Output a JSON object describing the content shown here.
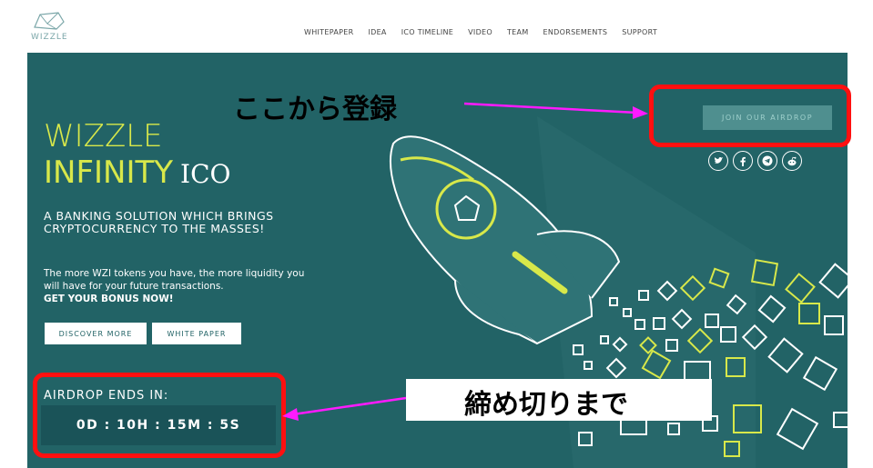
{
  "header": {
    "logo_text": "WIZZLE",
    "nav": [
      "WHITEPAPER",
      "IDEA",
      "ICO TIMELINE",
      "VIDEO",
      "TEAM",
      "ENDORSEMENTS",
      "SUPPORT"
    ]
  },
  "hero": {
    "title_line1": "WIZZLE",
    "title_line2": "INFINITY",
    "title_suffix": "ICO",
    "tagline": "A BANKING SOLUTION WHICH BRINGS CRYPTOCURRENCY TO THE MASSES!",
    "description": "The more WZI tokens you have, the more liquidity you will have for your future transactions.",
    "bonus": "GET YOUR BONUS NOW!",
    "discover_button": "DISCOVER MORE",
    "whitepaper_button": "WHITE PAPER",
    "airdrop_label": "AIRDROP ENDS IN:",
    "countdown": "0D : 10H : 15M : 5S",
    "join_button": "JOIN OUR AIRDROP",
    "social_icons": [
      "twitter-icon",
      "facebook-icon",
      "telegram-icon",
      "reddit-icon"
    ]
  },
  "annotations": {
    "register_here": "ここから登録",
    "until_deadline": "締め切りまで"
  },
  "colors": {
    "hero_bg": "#226366",
    "accent_yellow": "#d8e84a",
    "annotation_red": "#ff1010",
    "arrow_magenta": "#ff1aff"
  }
}
